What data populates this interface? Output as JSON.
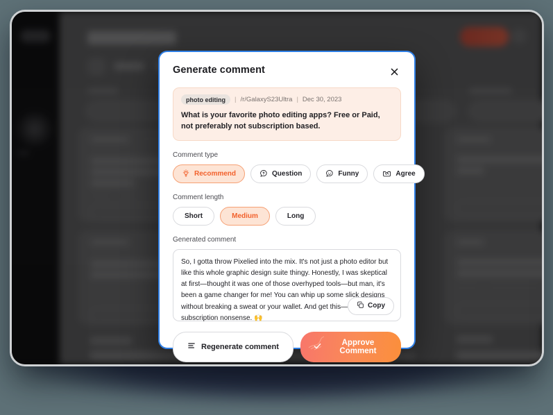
{
  "modal": {
    "title": "Generate comment",
    "close_icon": "close-icon",
    "post": {
      "tag": "photo editing",
      "separator": "|",
      "subreddit": "/r/GalaxyS23Ultra",
      "date": "Dec 30, 2023",
      "title": "What is your favorite photo editing apps? Free or Paid, not preferably not subscription based."
    },
    "comment_type": {
      "label": "Comment type",
      "options": [
        {
          "label": "Recommend",
          "icon": "lightbulb-icon",
          "active": true
        },
        {
          "label": "Question",
          "icon": "question-bubble-icon",
          "active": false
        },
        {
          "label": "Funny",
          "icon": "smiley-bubble-icon",
          "active": false
        },
        {
          "label": "Agree",
          "icon": "handshake-icon",
          "active": false
        }
      ]
    },
    "comment_length": {
      "label": "Comment length",
      "options": [
        {
          "label": "Short",
          "active": false
        },
        {
          "label": "Medium",
          "active": true
        },
        {
          "label": "Long",
          "active": false
        }
      ]
    },
    "generated": {
      "label": "Generated comment",
      "text": "So, I gotta throw Pixelied into the mix. It's not just a photo editor but like this whole graphic design suite thingy. Honestly, I was skeptical at first—thought it was one of those overhyped tools—but man, it's been a game changer for me! You can whip up some slick designs without breaking a sweat or your wallet. And get this—no subscription nonsense. 🙌",
      "copy_label": "Copy",
      "copy_icon": "copy-icon"
    },
    "footer": {
      "regenerate_label": "Regenerate comment",
      "regenerate_icon": "lines-icon",
      "approve_label": "Approve Comment",
      "approve_icon": "check-icon"
    }
  },
  "colors": {
    "accent": "#f2612c",
    "accent_soft": "#fde4d5",
    "primary_gradient_start": "#f8766b",
    "primary_gradient_end": "#fb8f3b",
    "modal_border": "#2f7fe6",
    "post_bg": "#fdeee6",
    "page_bg": "#5e7177"
  }
}
